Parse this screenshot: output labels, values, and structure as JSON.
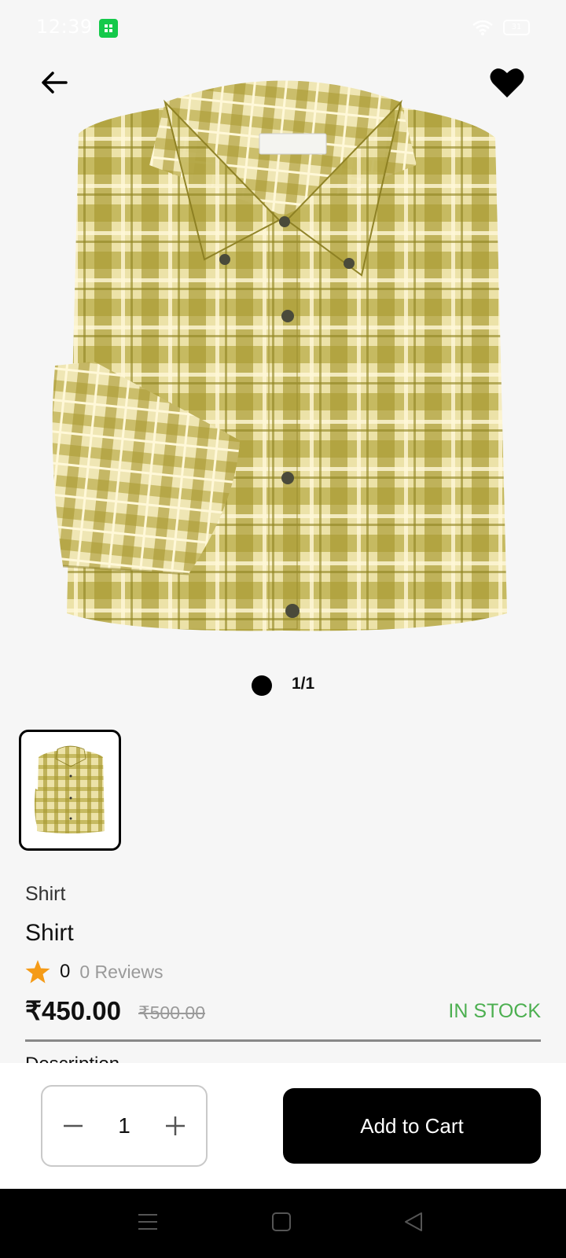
{
  "status_bar": {
    "time": "12:39",
    "battery": "31"
  },
  "header": {
    "back": "back",
    "favorite": "favorite"
  },
  "gallery": {
    "pager_text": "1/1"
  },
  "product": {
    "category": "Shirt",
    "title": "Shirt",
    "rating_value": "0",
    "reviews_text": "0 Reviews",
    "price": "₹450.00",
    "old_price": "₹500.00",
    "stock_status": "IN STOCK",
    "description_heading": "Description"
  },
  "cart": {
    "quantity": "1",
    "decrement_label": "−",
    "increment_label": "+",
    "add_to_cart_label": "Add to Cart"
  },
  "colors": {
    "accent": "#000000",
    "in_stock": "#4caf50",
    "star": "#f59b17",
    "shirt_base": "#e8dc9c",
    "shirt_check": "#a99a2c"
  },
  "icons": [
    "arrow-left-icon",
    "heart-icon",
    "star-icon",
    "minus-icon",
    "plus-icon",
    "menu-icon",
    "square-icon",
    "triangle-back-icon",
    "wifi-icon"
  ]
}
